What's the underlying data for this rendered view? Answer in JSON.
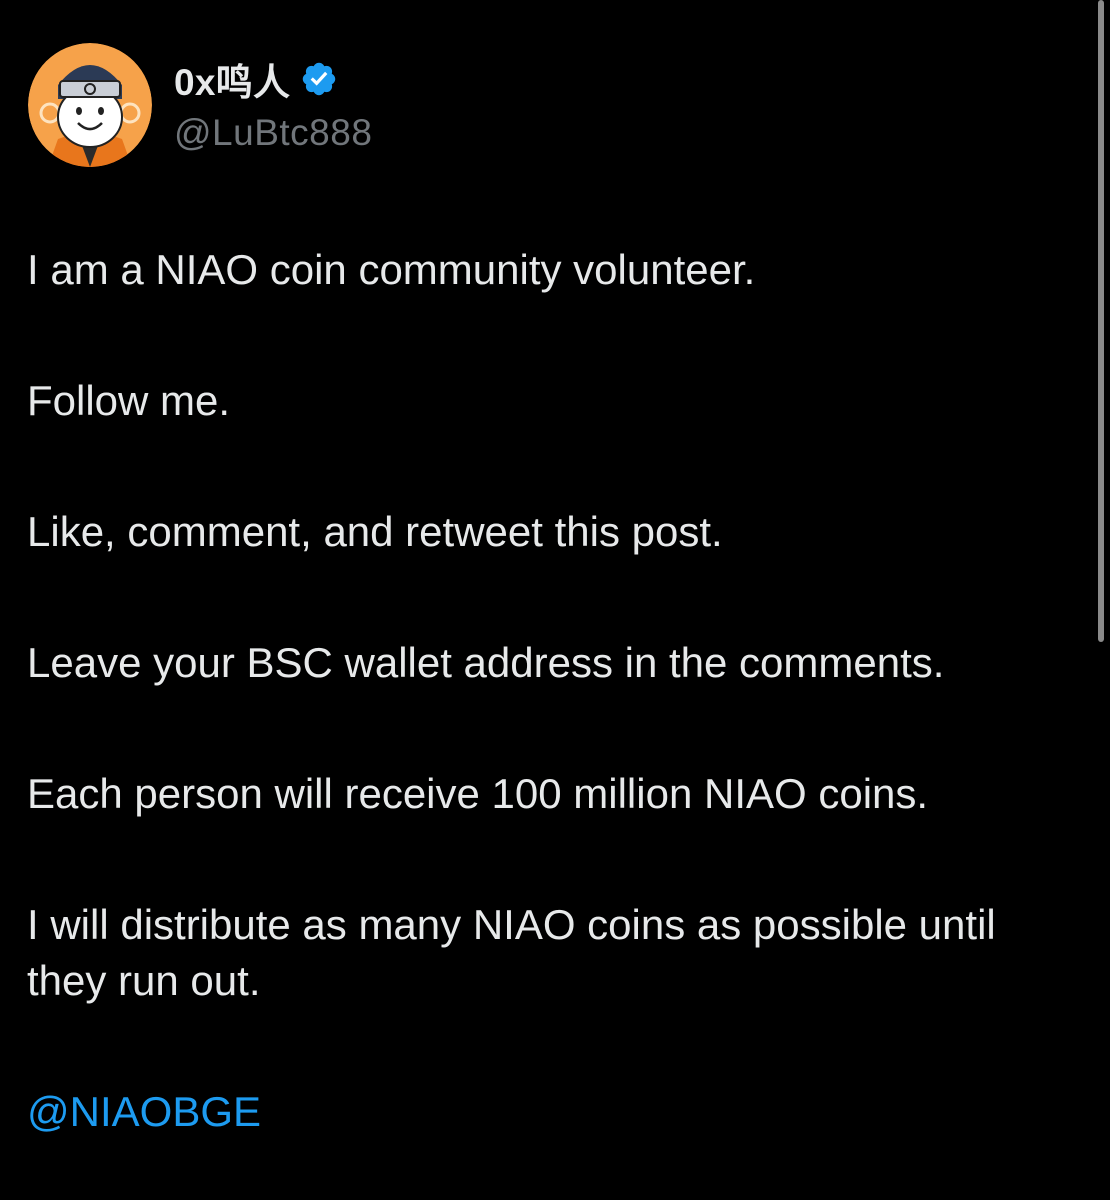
{
  "author": {
    "display_name": "0x鸣人",
    "handle": "@LuBtc888",
    "verified": true,
    "avatar_icon": "cartoon-ninja-avatar"
  },
  "post": {
    "paragraphs": [
      "I am a NIAO coin community volunteer.",
      "Follow me.",
      "Like, comment, and retweet this post.",
      "Leave your BSC wallet address in the comments.",
      "Each person will receive 100 million NIAO coins.",
      "I will distribute as many NIAO coins as possible until they run out."
    ],
    "mention": "@NIAOBGE"
  },
  "colors": {
    "background": "#000000",
    "text": "#e7e9ea",
    "secondary_text": "#71767b",
    "link": "#1d9bf0",
    "verified_badge": "#1d9bf0"
  }
}
